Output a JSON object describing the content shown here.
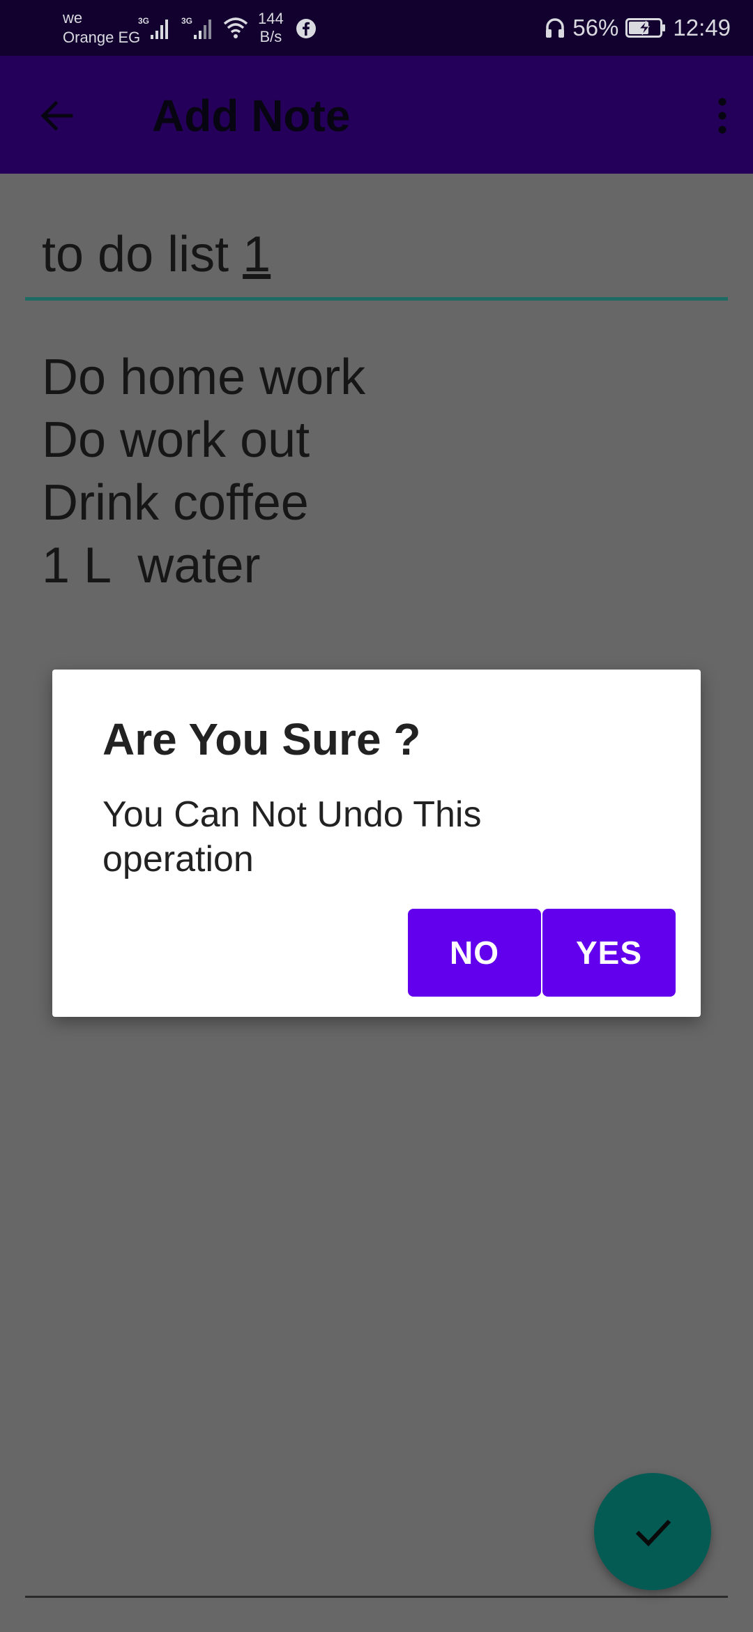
{
  "status_bar": {
    "carrier_1": "we",
    "carrier_2": "Orange EG",
    "network_1": "3G",
    "network_2": "3G",
    "speed_value": "144",
    "speed_unit": "B/s",
    "battery": "56%",
    "time": "12:49",
    "icons": [
      "signal-icon",
      "wifi-icon",
      "facebook-icon",
      "headphones-icon",
      "battery-charging-icon"
    ]
  },
  "app_bar": {
    "title": "Add Note",
    "icons": [
      "back-arrow-icon",
      "more-vert-icon"
    ]
  },
  "note": {
    "title_prefix": "to do list ",
    "title_suffix": "1",
    "body": "Do home work\nDo work out\nDrink coffee\n1 L  water"
  },
  "dialog": {
    "title": "Are You Sure ?",
    "message": "You Can Not Undo This operation",
    "no_label": "NO",
    "yes_label": "YES"
  },
  "fab": {
    "icon": "check-icon"
  },
  "colors": {
    "status_bar_bg": "#12002e",
    "app_bar_bg": "#25005a",
    "accent_button": "#6200ee",
    "fab_bg": "#035b54",
    "field_underline": "#1d6b62",
    "scrim_bg": "#676767"
  }
}
